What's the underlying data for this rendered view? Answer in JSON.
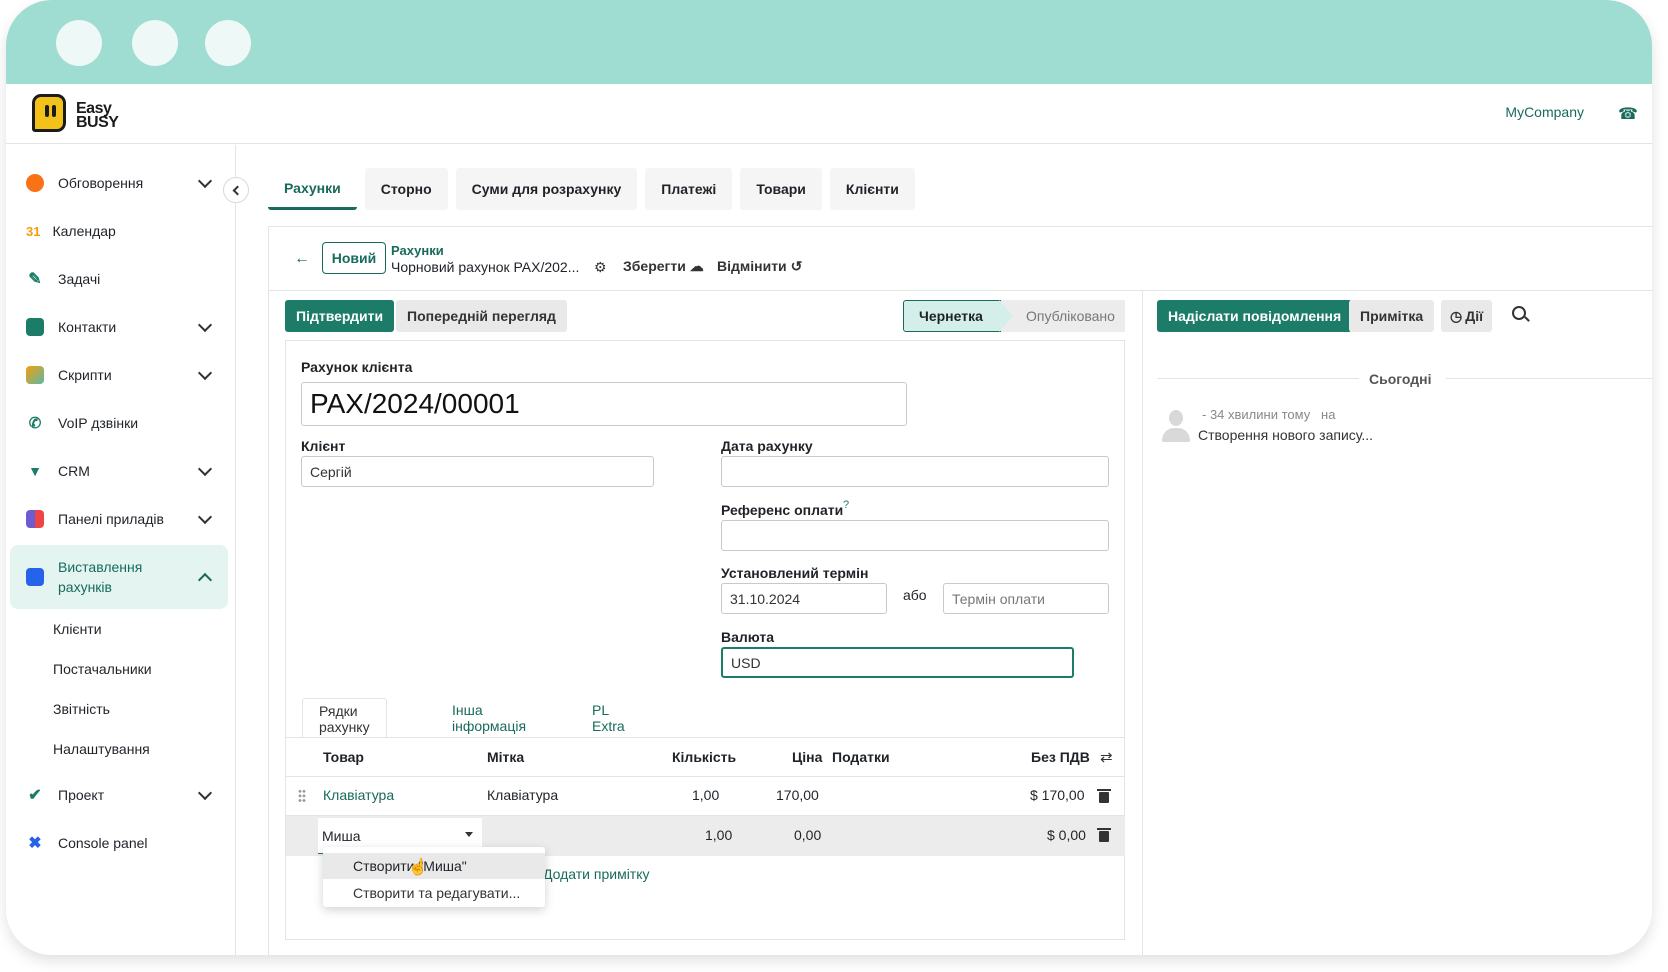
{
  "app": {
    "logo_text_1": "Easy",
    "logo_text_2": "BUSY",
    "company": "MyCompany",
    "phone_icon": "phone-icon"
  },
  "sidebar": {
    "items": [
      {
        "label": "Обговорення",
        "icon": "chat-icon",
        "color": "#f97316",
        "expandable": true
      },
      {
        "label": "Календар",
        "icon": "calendar-icon",
        "color": "#f59e0b",
        "glyph": "31",
        "expandable": false
      },
      {
        "label": "Задачі",
        "icon": "pencil-icon",
        "color": "#1c7c68",
        "expandable": false
      },
      {
        "label": "Контакти",
        "icon": "contacts-icon",
        "color": "#1c7c68",
        "expandable": true
      },
      {
        "label": "Скрипти",
        "icon": "scripts-icon",
        "color": "#5bb8a6",
        "expandable": true
      },
      {
        "label": "VoIP дзвінки",
        "icon": "phone-icon",
        "color": "#1c7c68",
        "expandable": false
      },
      {
        "label": "CRM",
        "icon": "crm-icon",
        "color": "#1c7c68",
        "expandable": true
      },
      {
        "label": "Панелі приладів",
        "icon": "dashboard-icon",
        "color": "#6d5bd0",
        "expandable": true
      },
      {
        "label": "Виставлення рахунків",
        "icon": "invoice-icon",
        "color": "#2563eb",
        "expandable": true,
        "active": true
      }
    ],
    "subitems": [
      "Клієнти",
      "Постачальники",
      "Звітність",
      "Налаштування"
    ],
    "bottom_items": [
      {
        "label": "Проект",
        "icon": "check-icon",
        "expandable": true
      },
      {
        "label": "Console panel",
        "icon": "tools-icon",
        "expandable": false
      }
    ]
  },
  "tabs": [
    "Рахунки",
    "Сторно",
    "Суми для розрахунку",
    "Платежі",
    "Товари",
    "Клієнти"
  ],
  "breadcrumb": {
    "new_button": "Новий",
    "parent": "Рахунки",
    "current": "Чорновий рахунок PAX/202...",
    "save": "Зберегти",
    "discard": "Відмінити"
  },
  "actions": {
    "confirm": "Підтвердити",
    "preview": "Попередній перегляд"
  },
  "status": {
    "draft": "Чернетка",
    "posted": "Опубліковано"
  },
  "form": {
    "invoice_label": "Рахунок клієнта",
    "invoice_number": "PAX/2024/00001",
    "client_label": "Клієнт",
    "client_value": "Сергій",
    "date_label": "Дата рахунку",
    "date_value": "",
    "payment_ref_label": "Референс оплати",
    "payment_ref_help": "?",
    "payment_ref_value": "",
    "due_label": "Установлений термін",
    "due_value": "31.10.2024",
    "or_label": "або",
    "payment_terms_placeholder": "Термін оплати",
    "currency_label": "Валюта",
    "currency_value": "USD"
  },
  "subtabs": [
    "Рядки рахунку",
    "Інша інформація",
    "PL Extra"
  ],
  "lines": {
    "columns": [
      "Товар",
      "Мітка",
      "Кількість",
      "Ціна",
      "Податки",
      "Без ПДВ"
    ],
    "rows": [
      {
        "product": "Клавіатура",
        "label": "Клавіатура",
        "qty": "1,00",
        "price": "170,00",
        "taxes": "",
        "subtotal": "$ 170,00"
      },
      {
        "product": "Миша",
        "label": "",
        "qty": "1,00",
        "price": "0,00",
        "taxes": "",
        "subtotal": "$ 0,00"
      }
    ],
    "dropdown_create": "Створити \"Миша\"",
    "dropdown_more": "Створити та редагувати...",
    "add_note": "Додати примітку"
  },
  "chatter": {
    "send_message": "Надіслати повідомлення",
    "note": "Примітка",
    "activities": "Дії",
    "today": "Сьогодні",
    "message_time": "- 34 хвилини тому",
    "message_on": "на",
    "message_text": "Створення нового запису..."
  }
}
